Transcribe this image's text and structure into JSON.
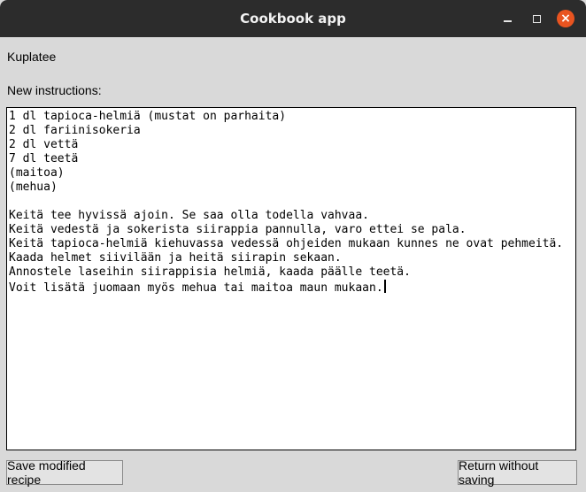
{
  "window": {
    "title": "Cookbook app"
  },
  "recipe": {
    "name": "Kuplatee"
  },
  "instructions": {
    "label": "New instructions:",
    "text": "1 dl tapioca-helmiä (mustat on parhaita)\n2 dl fariinisokeria\n2 dl vettä\n7 dl teetä\n(maitoa)\n(mehua)\n\nKeitä tee hyvissä ajoin. Se saa olla todella vahvaa.\nKeitä vedestä ja sokerista siirappia pannulla, varo ettei se pala.\nKeitä tapioca-helmiä kiehuvassa vedessä ohjeiden mukaan kunnes ne ovat pehmeitä.\nKaada helmet siivilään ja heitä siirapin sekaan.\nAnnostele laseihin siirappisia helmiä, kaada päälle teetä.\nVoit lisätä juomaan myös mehua tai maitoa maun mukaan."
  },
  "buttons": {
    "save_label": "Save modified recipe",
    "return_label": "Return without saving"
  },
  "colors": {
    "titlebar": "#2c2c2c",
    "close_button": "#e95420",
    "window_bg": "#d9d9d9"
  }
}
